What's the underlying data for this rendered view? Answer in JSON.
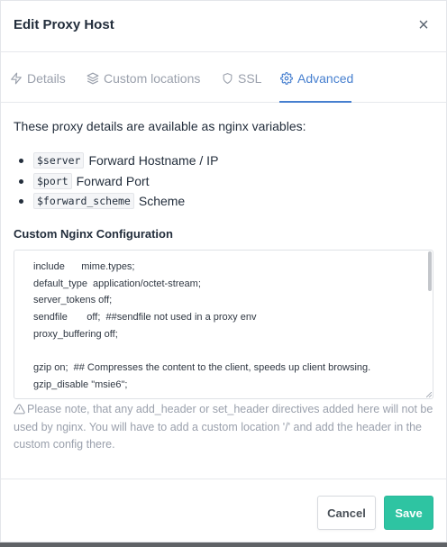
{
  "modal": {
    "title": "Edit Proxy Host",
    "close_glyph": "×"
  },
  "tabs": [
    {
      "label": "Details",
      "icon": "zap-icon",
      "active": false
    },
    {
      "label": "Custom locations",
      "icon": "layers-icon",
      "active": false
    },
    {
      "label": "SSL",
      "icon": "shield-icon",
      "active": false
    },
    {
      "label": "Advanced",
      "icon": "gear-icon",
      "active": true
    }
  ],
  "advanced": {
    "intro": "These proxy details are available as nginx variables:",
    "variables": [
      {
        "code": "$server",
        "desc": "Forward Hostname / IP"
      },
      {
        "code": "$port",
        "desc": "Forward Port"
      },
      {
        "code": "$forward_scheme",
        "desc": "Scheme"
      }
    ],
    "config_label": "Custom Nginx Configuration",
    "config_lines": [
      "include      mime.types;",
      "default_type  application/octet-stream;",
      "server_tokens off;",
      "sendfile       off;  ##sendfile not used in a proxy env",
      "proxy_buffering off;",
      "",
      "gzip on;  ## Compresses the content to the client, speeds up client browsing.",
      "gzip_disable \"msie6\";"
    ],
    "note": "Please note, that any add_header or set_header directives added here will not be used by nginx. You will have to add a custom location '/' and add the header in the custom config there."
  },
  "footer": {
    "cancel_label": "Cancel",
    "save_label": "Save"
  },
  "colors": {
    "accent": "#467fcf",
    "save": "#2ec4a2",
    "muted": "#9aa0ac"
  }
}
